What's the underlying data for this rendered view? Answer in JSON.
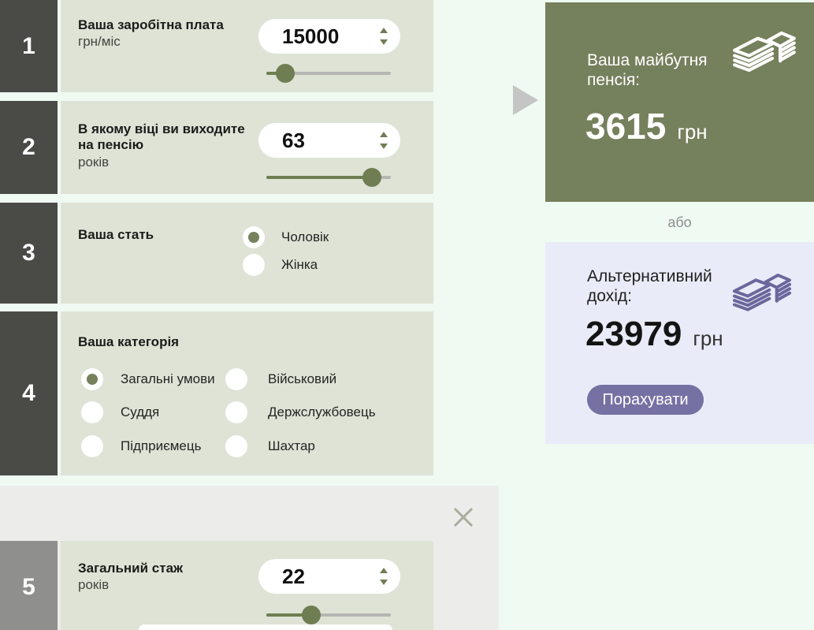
{
  "steps": [
    {
      "number": "1",
      "title": "Ваша заробітна плата",
      "unit": "грн/міс",
      "value": "15000",
      "slider_percent": 15
    },
    {
      "number": "2",
      "title": "В якому віці ви виходите на пенсію",
      "unit": "років",
      "value": "63",
      "slider_percent": 85
    },
    {
      "number": "3",
      "title": "Ваша стать",
      "options": [
        {
          "label": "Чоловік",
          "selected": true
        },
        {
          "label": "Жінка",
          "selected": false
        }
      ]
    },
    {
      "number": "4",
      "title": "Ваша категорія",
      "options_col1": [
        {
          "label": "Загальні умови",
          "selected": true
        },
        {
          "label": "Суддя",
          "selected": false
        },
        {
          "label": "Підприємець",
          "selected": false
        }
      ],
      "options_col2": [
        {
          "label": "Військовий",
          "selected": false
        },
        {
          "label": "Держслужбовець",
          "selected": false
        },
        {
          "label": "Шахтар",
          "selected": false
        }
      ]
    },
    {
      "number": "5",
      "title": "Загальний стаж",
      "unit": "років",
      "value": "22",
      "slider_percent": 36
    }
  ],
  "result_panel": {
    "title": "Ваша майбутня пенсія:",
    "value": "3615",
    "currency": "грн",
    "icon": "money-stack-icon"
  },
  "divider_label": "або",
  "alt_panel": {
    "title": "Альтернативний дохід:",
    "value": "23979",
    "currency": "грн",
    "button_label": "Порахувати",
    "icon": "money-stack-icon"
  },
  "overlay": {
    "close_icon": "close-x-icon"
  },
  "colors": {
    "accent_olive": "#6f7e52",
    "radio_dot_olive": "#75815b",
    "result_green": "#75805c",
    "alt_lavender": "#e9ecf8",
    "button_purple": "#7671a3",
    "icon_purple": "#6b669b",
    "step_box_dark": "#4a4a47",
    "step_box_muted": "#8f8f8d",
    "panel_sage": "#dee3d6",
    "page_mint": "#effaf3",
    "overlay_gray": "#ececeb"
  }
}
